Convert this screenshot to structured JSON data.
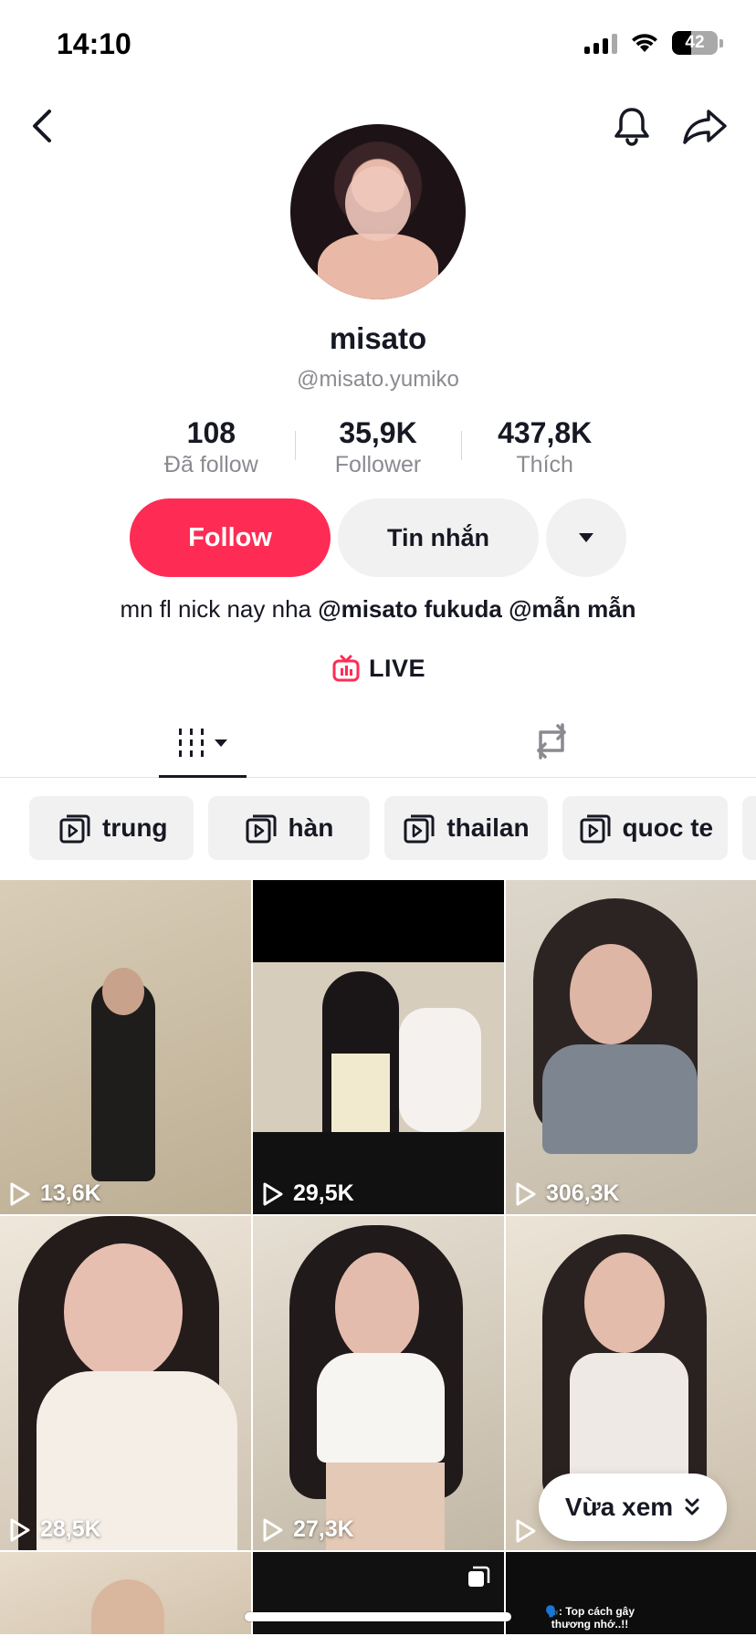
{
  "status_bar": {
    "time": "14:10",
    "battery_level": "42",
    "battery_fraction": 0.42
  },
  "profile": {
    "display_name": "misato",
    "username": "@misato.yumiko",
    "stats": [
      {
        "value": "108",
        "label": "Đã follow"
      },
      {
        "value": "35,9K",
        "label": "Follower"
      },
      {
        "value": "437,8K",
        "label": "Thích"
      }
    ],
    "follow_label": "Follow",
    "message_label": "Tin nhắn",
    "bio_text": "mn fl nick nay nha ",
    "bio_mentions": [
      "@misato fukuda",
      "@mẫn mẫn"
    ],
    "live_label": "LIVE"
  },
  "playlists": [
    "trung",
    "hàn",
    "thailan",
    "quoc te"
  ],
  "videos": [
    {
      "views": "13,6K"
    },
    {
      "views": "29,5K"
    },
    {
      "views": "306,3K"
    },
    {
      "views": "28,5K"
    },
    {
      "views": "27,3K"
    },
    {
      "views": ""
    }
  ],
  "bottom_row_caption": "🗣️: Top cách gây thương nhớ..!!",
  "recent_button_label": "Vừa xem",
  "colors": {
    "accent": "#fe2c55",
    "text": "#161823",
    "muted": "#8a8b91",
    "chip_bg": "#f1f1f2"
  },
  "icons": [
    "back-icon",
    "bell-icon",
    "share-icon",
    "caret-down-icon",
    "live-tv-icon",
    "grid-icon",
    "repost-icon",
    "playlist-icon",
    "play-icon",
    "chevron-double-down-icon",
    "multi-photo-icon"
  ]
}
